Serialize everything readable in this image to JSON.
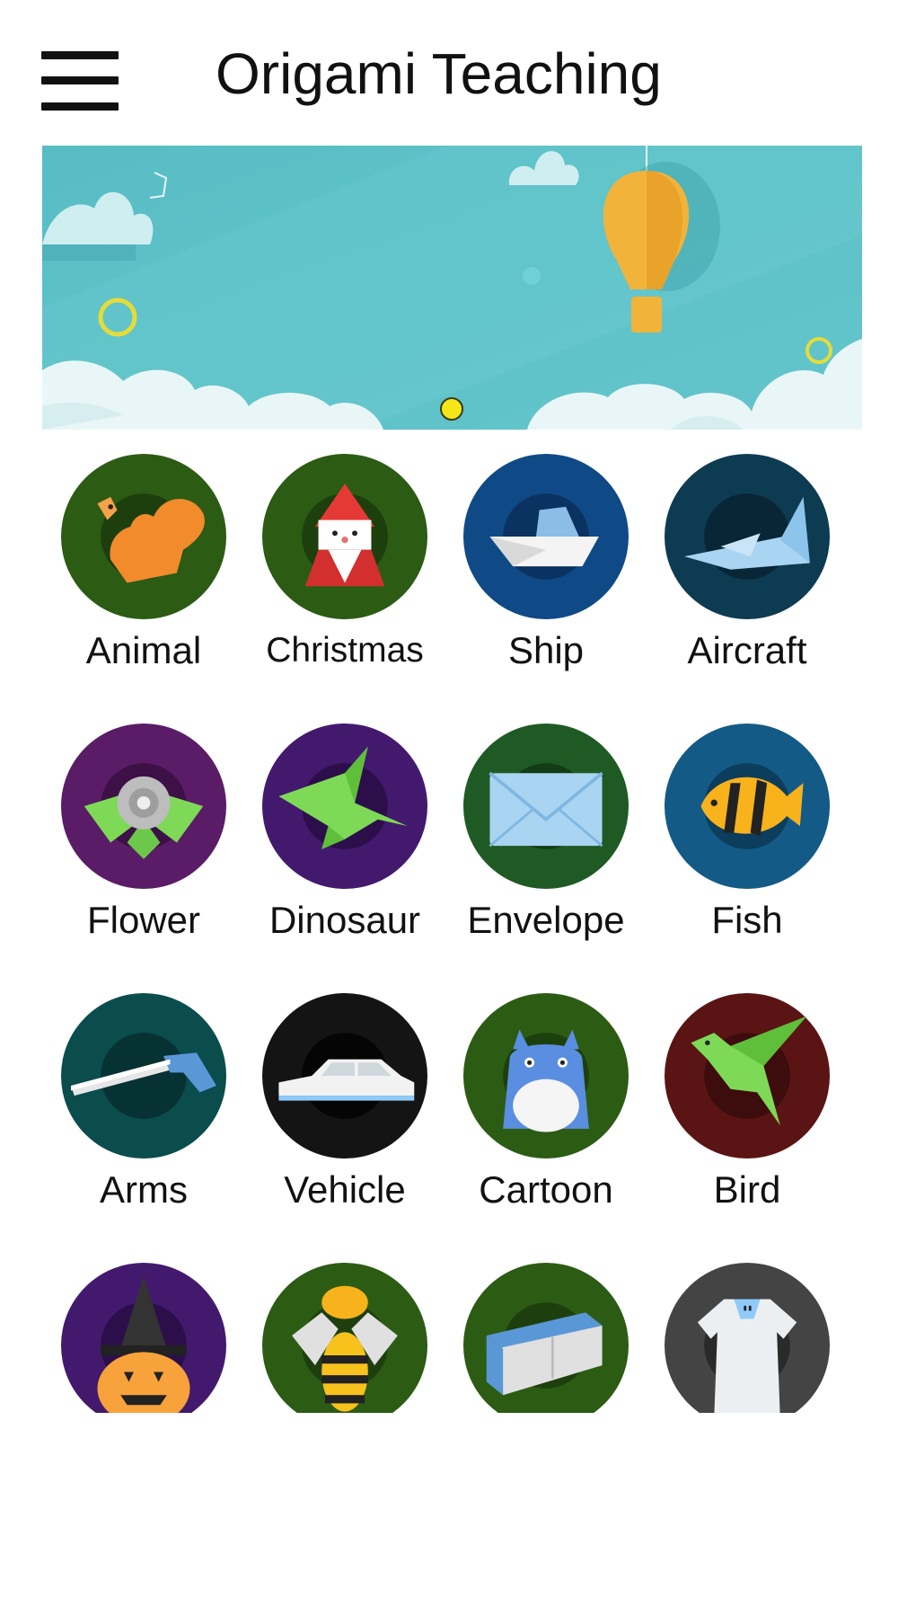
{
  "header": {
    "title": "Origami Teaching",
    "menu_icon": "hamburger-menu-icon"
  },
  "banner": {
    "pages": 1,
    "current_page": 1,
    "indicator_color": "#f5e61a",
    "sky_color": "#5fc3c9",
    "balloon_color": "#f2b33a"
  },
  "categories": [
    {
      "label": "Animal",
      "icon": "squirrel-icon",
      "color": "#2c5b14"
    },
    {
      "label": "Christmas",
      "icon": "santa-icon",
      "color": "#2c5b14"
    },
    {
      "label": "Ship",
      "icon": "ship-icon",
      "color": "#0f4a86"
    },
    {
      "label": "Aircraft",
      "icon": "airplane-icon",
      "color": "#0d3b52"
    },
    {
      "label": "Flower",
      "icon": "rose-icon",
      "color": "#5a1c66"
    },
    {
      "label": "Dinosaur",
      "icon": "dinosaur-icon",
      "color": "#43196e"
    },
    {
      "label": "Envelope",
      "icon": "envelope-icon",
      "color": "#1f5a24"
    },
    {
      "label": "Fish",
      "icon": "fish-icon",
      "color": "#135a86"
    },
    {
      "label": "Arms",
      "icon": "gun-icon",
      "color": "#0b4c4d"
    },
    {
      "label": "Vehicle",
      "icon": "car-icon",
      "color": "#141414"
    },
    {
      "label": "Cartoon",
      "icon": "totoro-icon",
      "color": "#2c5b14"
    },
    {
      "label": "Bird",
      "icon": "bird-icon",
      "color": "#5a1414"
    },
    {
      "label": "",
      "icon": "pumpkin-icon",
      "color": "#43196e"
    },
    {
      "label": "",
      "icon": "bee-icon",
      "color": "#2c5b14"
    },
    {
      "label": "",
      "icon": "sofa-icon",
      "color": "#2c5b14"
    },
    {
      "label": "",
      "icon": "shirt-icon",
      "color": "#444444"
    }
  ]
}
